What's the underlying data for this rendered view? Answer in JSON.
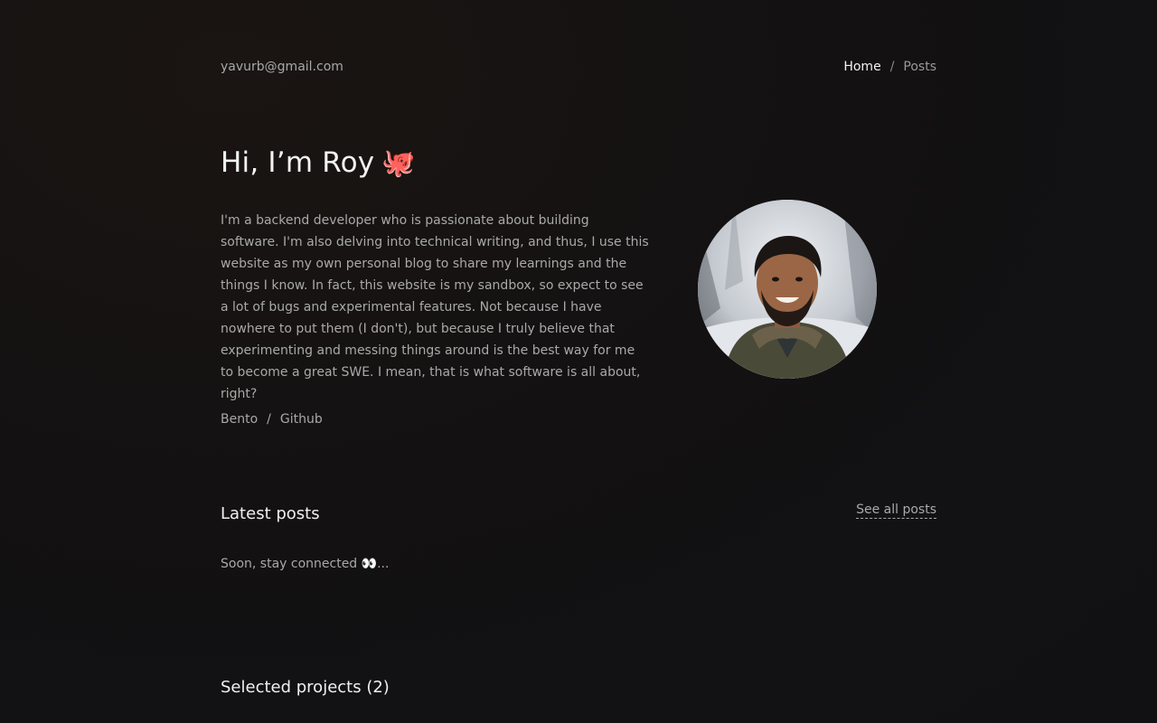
{
  "header": {
    "email": "yavurb@gmail.com",
    "nav": {
      "home": "Home",
      "separator": "/",
      "posts": "Posts"
    }
  },
  "hero": {
    "title": "Hi, I’m Roy",
    "emoji": "🐙",
    "bio": "I'm a backend developer who is passionate about building software. I'm also delving into technical writing, and thus, I use this website as my own personal blog to share my learnings and the things I know. In fact, this website is my sandbox, so expect to see a lot of bugs and experimental features. Not because I have nowhere to put them (I don't), but because I truly believe that experimenting and messing things around is the best way for me to become a great SWE. I mean, that is what software is all about, right?",
    "links": {
      "bento": "Bento",
      "separator": "/",
      "github": "Github"
    }
  },
  "latest_posts": {
    "title": "Latest posts",
    "see_all": "See all posts",
    "empty_message": "Soon, stay connected 👀..."
  },
  "projects": {
    "title": "Selected projects (2)"
  },
  "colors": {
    "background": "#121113",
    "accent_emoji": "#ff6b6b",
    "text_primary": "#f0f0f0",
    "text_secondary": "#a9a9a9"
  }
}
